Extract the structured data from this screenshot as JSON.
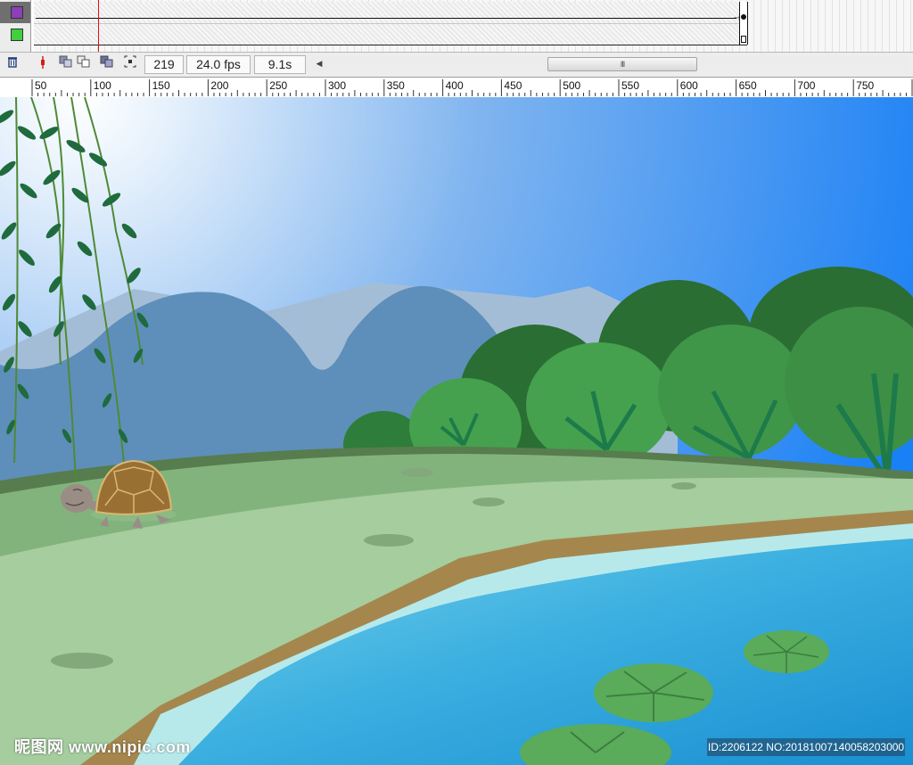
{
  "timeline": {
    "layers": [
      {
        "swatch_color": "#8b3fb8",
        "icon": "layer-outline-swatch-icon"
      },
      {
        "swatch_color": "#3fcf3f",
        "icon": "layer-outline-swatch-icon"
      }
    ]
  },
  "statusbar": {
    "buttons": [
      "trash-icon",
      "center-frame-icon",
      "onion-skin-icon",
      "onion-skin-outlines-icon",
      "edit-multiple-frames-icon",
      "modify-onion-markers-icon"
    ],
    "current_frame": "219",
    "frame_rate": "24.0 fps",
    "elapsed_time": "9.1s",
    "scroll_thumb_grip": "III",
    "scroll_left_arrow": "◀"
  },
  "ruler": {
    "labels": [
      "50",
      "100",
      "150",
      "200",
      "250",
      "300",
      "350",
      "400",
      "450",
      "500",
      "550",
      "600",
      "650",
      "700",
      "750"
    ]
  },
  "stage": {
    "sky_colors": [
      "#ffffff",
      "#1a80f5"
    ],
    "water_color": "#4fb8e0",
    "grass_color": "#a5cd9e"
  },
  "watermark": {
    "left": "昵图网 www.nipic.com",
    "right": "ID:2206122 NO:20181007140058203000"
  }
}
